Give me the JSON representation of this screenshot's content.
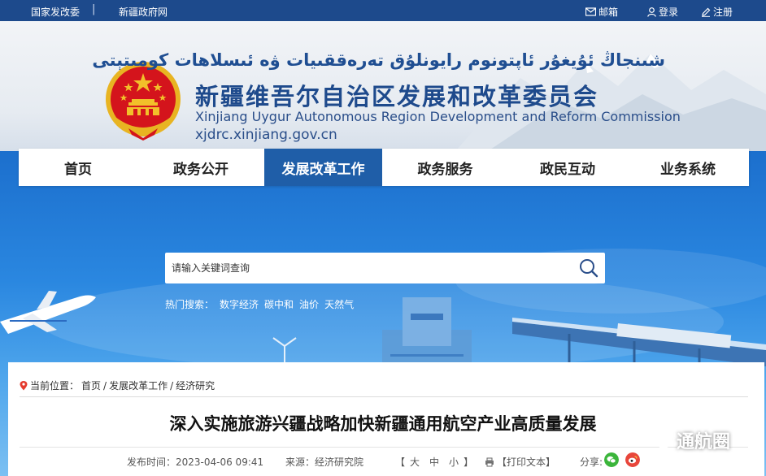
{
  "topbar": {
    "links": [
      "国家发改委",
      "新疆政府网"
    ],
    "separator": "|",
    "mailbox": "邮箱",
    "login": "登录",
    "register": "注册"
  },
  "header": {
    "uyghur_name": "شىنجاڭ ئۇيغۇر ئاپتونوم رايونلۇق تەرەققىيات ۋە ئىسلاھات كومىتېتى",
    "cn_name": "新疆维吾尔自治区发展和改革委员会",
    "en_name": "Xinjiang Uygur Autonomous Region Development and Reform Commission",
    "domain": "xjdrc.xinjiang.gov.cn"
  },
  "nav": {
    "items": [
      "首页",
      "政务公开",
      "发展改革工作",
      "政务服务",
      "政民互动",
      "业务系统"
    ],
    "active": "发展改革工作"
  },
  "search": {
    "placeholder": "请输入关键词查询"
  },
  "hot": {
    "label": "热门搜索：",
    "keywords": [
      "数字经济",
      "碳中和",
      "油价",
      "天然气"
    ]
  },
  "breadcrumb": {
    "label": "当前位置：",
    "items": [
      "首页",
      "发展改革工作",
      "经济研究"
    ],
    "sep": "/"
  },
  "article": {
    "title": "深入实施旅游兴疆战略加快新疆通用航空产业高质量发展",
    "publish_time": "发布时间：2023-04-06 09:41",
    "source": "来源：经济研究院",
    "font_open": "【",
    "font_sizes": [
      "大",
      "中",
      "小"
    ],
    "font_close": "】",
    "print": "【打印文本】",
    "share": "分享:"
  },
  "watermark": "通航圈",
  "colors": {
    "topbar": "#1d4a8c",
    "nav_active": "#1f5ea8",
    "hero": "#2a87e0"
  },
  "icons": [
    "mail-icon",
    "user-icon",
    "edit-icon",
    "search-icon",
    "location-icon",
    "print-icon",
    "wechat-icon",
    "weibo-icon"
  ]
}
